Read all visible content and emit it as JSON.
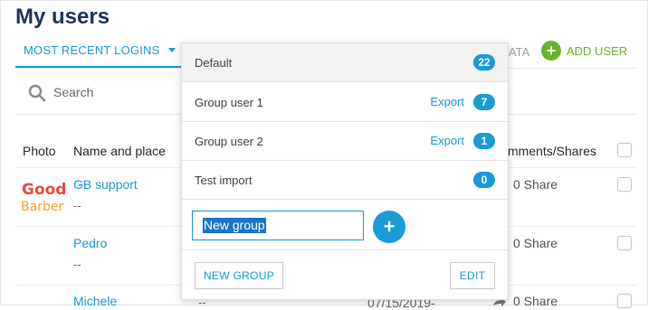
{
  "page": {
    "title": "My users"
  },
  "tabs": {
    "active_label": "MOST RECENT LOGINS",
    "partial_label": "ATA"
  },
  "actions": {
    "add_user_label": "ADD USER"
  },
  "search": {
    "placeholder": "Search"
  },
  "table": {
    "headers": {
      "photo": "Photo",
      "name": "Name and place",
      "comments": "mments/Shares"
    },
    "rows": [
      {
        "name": "GB support",
        "place": "--",
        "shares": "0 Share"
      },
      {
        "name": "Pedro",
        "place": "--",
        "shares": "0 Share"
      },
      {
        "name": "Michele",
        "place": "--",
        "date": "07/15/2019-",
        "shares": "0 Share"
      }
    ]
  },
  "logo": {
    "line1": "Good",
    "line2": "Barber"
  },
  "dropdown": {
    "groups": [
      {
        "label": "Default",
        "count": "22",
        "export": ""
      },
      {
        "label": "Group user 1",
        "count": "7",
        "export": "Export"
      },
      {
        "label": "Group user 2",
        "count": "1",
        "export": "Export"
      },
      {
        "label": "Test import",
        "count": "0",
        "export": ""
      }
    ],
    "new_group_value": "New group",
    "new_group_button": "NEW GROUP",
    "edit_button": "EDIT"
  },
  "colors": {
    "accent": "#1a9bd7",
    "green": "#69b42b",
    "title": "#1d3557"
  }
}
